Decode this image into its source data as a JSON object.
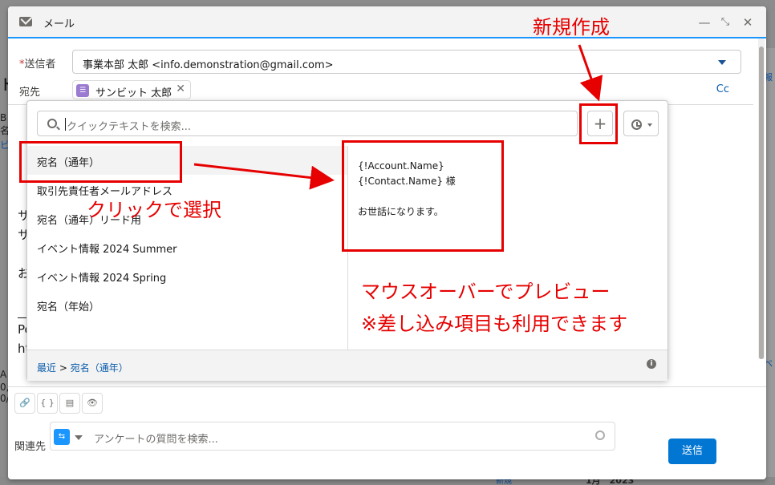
{
  "background": {
    "left_fragments": [
      "ト",
      "B",
      "名",
      "ビ",
      "ナ",
      "サ",
      "先",
      "お",
      "Po",
      "ht",
      "A",
      "0,",
      "0/"
    ],
    "right_fragments": [
      "報",
      "ベ"
    ],
    "bottom_left": "新規",
    "bottom_right": "1月　2023"
  },
  "mail": {
    "title": "メール",
    "icon": "envelope-icon",
    "window_controls": [
      "minimize-icon",
      "pop-out-icon",
      "close-icon"
    ],
    "from_label": "送信者",
    "from_value": "事業本部 太郎 <info.demonstration@gmail.com>",
    "to_label": "宛先",
    "to_recipient": "サンビット 太郎",
    "cc_label": "Cc",
    "body_fragments": [
      "サ",
      "サ",
      "お",
      "Po",
      "ht"
    ],
    "related_label": "関連先",
    "related_placeholder": "アンケートの質問を検索...",
    "send_label": "送信",
    "tools": [
      "attach-icon",
      "merge-field-icon",
      "template-icon",
      "preview-icon"
    ],
    "tool_glyphs": [
      "🔗",
      "{ }",
      "▤",
      "👁"
    ]
  },
  "quick_text": {
    "search_placeholder": "クイックテキストを検索...",
    "new_button": "+",
    "items": [
      "宛名（通年）",
      "取引先責任者メールアドレス",
      "宛名（通年）リード用",
      "イベント情報 2024 Summer",
      "イベント情報 2024 Spring",
      "宛名（年始）"
    ],
    "selected_index": 0,
    "preview_lines": [
      "{!Account.Name}",
      "{!Contact.Name} 様",
      "",
      "お世話になります。"
    ],
    "breadcrumb_root": "最近",
    "breadcrumb_sep": ">",
    "breadcrumb_current": "宛名（通年）"
  },
  "annotations": {
    "new_label": "新規作成",
    "click_label": "クリックで選択",
    "hover_line1": "マウスオーバーでプレビュー",
    "hover_line2": "※差し込み項目も利用できます",
    "color": "#e60000"
  }
}
